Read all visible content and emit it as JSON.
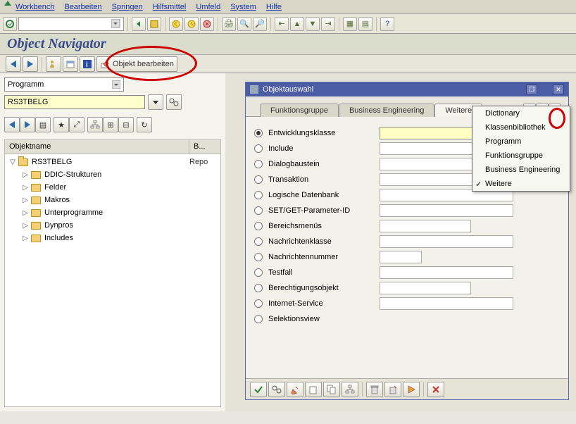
{
  "menu": {
    "items": [
      "Workbench",
      "Bearbeiten",
      "Springen",
      "Hilfsmittel",
      "Umfeld",
      "System",
      "Hilfe"
    ]
  },
  "title": "Object Navigator",
  "app_toolbar": {
    "edit_label": "Objekt bearbeiten"
  },
  "left": {
    "combo_label": "Programm",
    "input_value": "RS3TBELG",
    "tree_header": {
      "c1": "Objektname",
      "c2": "B..."
    },
    "root": {
      "label": "RS3TBELG",
      "desc": "Repo"
    },
    "children": [
      "DDIC-Strukturen",
      "Felder",
      "Makros",
      "Unterprogramme",
      "Dynpros",
      "Includes"
    ]
  },
  "modal": {
    "title": "Objektauswahl",
    "tabs": [
      "Funktionsgruppe",
      "Business Engineering",
      "Weitere"
    ],
    "active_tab": "Weitere",
    "dropdown": [
      "Dictionary",
      "Klassenbibliothek",
      "Programm",
      "Funktionsgruppe",
      "Business Engineering",
      "Weitere"
    ],
    "dropdown_checked": "Weitere",
    "radios": [
      {
        "label": "Entwicklungsklasse",
        "field": "active"
      },
      {
        "label": "Include",
        "field": "normal"
      },
      {
        "label": "Dialogbaustein",
        "field": "normal"
      },
      {
        "label": "Transaktion",
        "field": "normal"
      },
      {
        "label": "Logische Datenbank",
        "field": "normal"
      },
      {
        "label": "SET/GET-Parameter-ID",
        "field": "normal"
      },
      {
        "label": "Bereichsmenüs",
        "field": "med"
      },
      {
        "label": "Nachrichtenklasse",
        "field": "normal"
      },
      {
        "label": "Nachrichtennummer",
        "field": "short"
      },
      {
        "label": "Testfall",
        "field": "normal"
      },
      {
        "label": "Berechtigungsobjekt",
        "field": "med"
      },
      {
        "label": "Internet-Service",
        "field": "normal"
      },
      {
        "label": "Selektionsview",
        "field": "none"
      }
    ],
    "selected_radio": 0
  },
  "colors": {
    "accent_blue": "#4c5da6",
    "ellipse": "#c00"
  }
}
